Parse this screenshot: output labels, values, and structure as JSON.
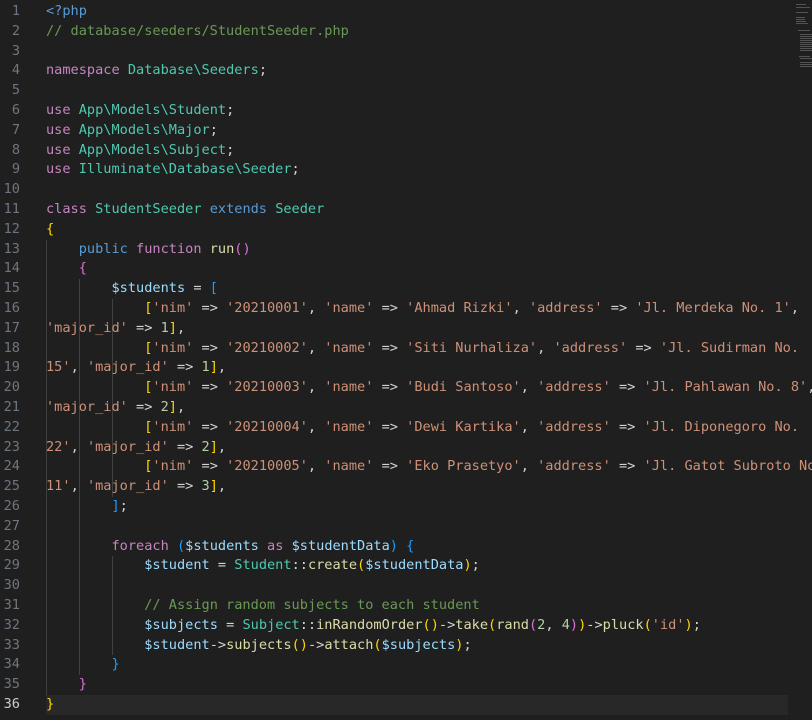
{
  "editor": {
    "file_comment": "// database/seeders/StudentSeeder.php",
    "active_line": 36,
    "line_numbers": [
      "1",
      "2",
      "3",
      "4",
      "5",
      "6",
      "7",
      "8",
      "9",
      "10",
      "11",
      "12",
      "13",
      "14",
      "15",
      "16",
      "17",
      "18",
      "19",
      "20",
      "21",
      "22",
      "23",
      "24",
      "25",
      "26",
      "27",
      "28",
      "29",
      "30",
      "31",
      "32",
      "33",
      "34",
      "35",
      "36"
    ],
    "lines": [
      [
        [
          "tok-php",
          "<?php"
        ]
      ],
      [
        [
          "tok-com",
          "// database/seeders/StudentSeeder.php"
        ]
      ],
      [],
      [
        [
          "tok-kw",
          "namespace"
        ],
        [
          "tok-op",
          " "
        ],
        [
          "tok-cls",
          "Database\\Seeders"
        ],
        [
          "tok-op",
          ";"
        ]
      ],
      [],
      [
        [
          "tok-kw",
          "use"
        ],
        [
          "tok-op",
          " "
        ],
        [
          "tok-cls",
          "App\\Models\\Student"
        ],
        [
          "tok-op",
          ";"
        ]
      ],
      [
        [
          "tok-kw",
          "use"
        ],
        [
          "tok-op",
          " "
        ],
        [
          "tok-cls",
          "App\\Models\\Major"
        ],
        [
          "tok-op",
          ";"
        ]
      ],
      [
        [
          "tok-kw",
          "use"
        ],
        [
          "tok-op",
          " "
        ],
        [
          "tok-cls",
          "App\\Models\\Subject"
        ],
        [
          "tok-op",
          ";"
        ]
      ],
      [
        [
          "tok-kw",
          "use"
        ],
        [
          "tok-op",
          " "
        ],
        [
          "tok-cls",
          "Illuminate\\Database\\Seeder"
        ],
        [
          "tok-op",
          ";"
        ]
      ],
      [],
      [
        [
          "tok-kw",
          "class"
        ],
        [
          "tok-op",
          " "
        ],
        [
          "tok-cls",
          "StudentSeeder"
        ],
        [
          "tok-op",
          " "
        ],
        [
          "tok-kw2",
          "extends"
        ],
        [
          "tok-op",
          " "
        ],
        [
          "tok-cls",
          "Seeder"
        ]
      ],
      [
        [
          "tok-b1",
          "{"
        ]
      ],
      [
        [
          "tok-op",
          "    "
        ],
        [
          "tok-decl",
          "public"
        ],
        [
          "tok-op",
          " "
        ],
        [
          "tok-kw",
          "function"
        ],
        [
          "tok-op",
          " "
        ],
        [
          "tok-fn",
          "run"
        ],
        [
          "tok-b2",
          "()"
        ]
      ],
      [
        [
          "tok-op",
          "    "
        ],
        [
          "tok-b2",
          "{"
        ]
      ],
      [
        [
          "tok-op",
          "        "
        ],
        [
          "tok-var",
          "$students"
        ],
        [
          "tok-op",
          " = "
        ],
        [
          "tok-b3",
          "["
        ]
      ],
      [
        [
          "tok-op",
          "            "
        ],
        [
          "tok-b1",
          "["
        ],
        [
          "tok-str",
          "'nim'"
        ],
        [
          "tok-op",
          " => "
        ],
        [
          "tok-str",
          "'20210001'"
        ],
        [
          "tok-op",
          ", "
        ],
        [
          "tok-str",
          "'name'"
        ],
        [
          "tok-op",
          " => "
        ],
        [
          "tok-str",
          "'Ahmad Rizki'"
        ],
        [
          "tok-op",
          ", "
        ],
        [
          "tok-str",
          "'address'"
        ],
        [
          "tok-op",
          " => "
        ],
        [
          "tok-str",
          "'Jl. Merdeka No. 1'"
        ],
        [
          "tok-op",
          ","
        ]
      ],
      [
        [
          "tok-str",
          "'major_id'"
        ],
        [
          "tok-op",
          " => "
        ],
        [
          "tok-num",
          "1"
        ],
        [
          "tok-b1",
          "]"
        ],
        [
          "tok-op",
          ","
        ]
      ],
      [
        [
          "tok-op",
          "            "
        ],
        [
          "tok-b1",
          "["
        ],
        [
          "tok-str",
          "'nim'"
        ],
        [
          "tok-op",
          " => "
        ],
        [
          "tok-str",
          "'20210002'"
        ],
        [
          "tok-op",
          ", "
        ],
        [
          "tok-str",
          "'name'"
        ],
        [
          "tok-op",
          " => "
        ],
        [
          "tok-str",
          "'Siti Nurhaliza'"
        ],
        [
          "tok-op",
          ", "
        ],
        [
          "tok-str",
          "'address'"
        ],
        [
          "tok-op",
          " => "
        ],
        [
          "tok-str",
          "'Jl. Sudirman No."
        ]
      ],
      [
        [
          "tok-str",
          "15'"
        ],
        [
          "tok-op",
          ", "
        ],
        [
          "tok-str",
          "'major_id'"
        ],
        [
          "tok-op",
          " => "
        ],
        [
          "tok-num",
          "1"
        ],
        [
          "tok-b1",
          "]"
        ],
        [
          "tok-op",
          ","
        ]
      ],
      [
        [
          "tok-op",
          "            "
        ],
        [
          "tok-b1",
          "["
        ],
        [
          "tok-str",
          "'nim'"
        ],
        [
          "tok-op",
          " => "
        ],
        [
          "tok-str",
          "'20210003'"
        ],
        [
          "tok-op",
          ", "
        ],
        [
          "tok-str",
          "'name'"
        ],
        [
          "tok-op",
          " => "
        ],
        [
          "tok-str",
          "'Budi Santoso'"
        ],
        [
          "tok-op",
          ", "
        ],
        [
          "tok-str",
          "'address'"
        ],
        [
          "tok-op",
          " => "
        ],
        [
          "tok-str",
          "'Jl. Pahlawan No. 8'"
        ],
        [
          "tok-op",
          ","
        ]
      ],
      [
        [
          "tok-str",
          "'major_id'"
        ],
        [
          "tok-op",
          " => "
        ],
        [
          "tok-num",
          "2"
        ],
        [
          "tok-b1",
          "]"
        ],
        [
          "tok-op",
          ","
        ]
      ],
      [
        [
          "tok-op",
          "            "
        ],
        [
          "tok-b1",
          "["
        ],
        [
          "tok-str",
          "'nim'"
        ],
        [
          "tok-op",
          " => "
        ],
        [
          "tok-str",
          "'20210004'"
        ],
        [
          "tok-op",
          ", "
        ],
        [
          "tok-str",
          "'name'"
        ],
        [
          "tok-op",
          " => "
        ],
        [
          "tok-str",
          "'Dewi Kartika'"
        ],
        [
          "tok-op",
          ", "
        ],
        [
          "tok-str",
          "'address'"
        ],
        [
          "tok-op",
          " => "
        ],
        [
          "tok-str",
          "'Jl. Diponegoro No."
        ]
      ],
      [
        [
          "tok-str",
          "22'"
        ],
        [
          "tok-op",
          ", "
        ],
        [
          "tok-str",
          "'major_id'"
        ],
        [
          "tok-op",
          " => "
        ],
        [
          "tok-num",
          "2"
        ],
        [
          "tok-b1",
          "]"
        ],
        [
          "tok-op",
          ","
        ]
      ],
      [
        [
          "tok-op",
          "            "
        ],
        [
          "tok-b1",
          "["
        ],
        [
          "tok-str",
          "'nim'"
        ],
        [
          "tok-op",
          " => "
        ],
        [
          "tok-str",
          "'20210005'"
        ],
        [
          "tok-op",
          ", "
        ],
        [
          "tok-str",
          "'name'"
        ],
        [
          "tok-op",
          " => "
        ],
        [
          "tok-str",
          "'Eko Prasetyo'"
        ],
        [
          "tok-op",
          ", "
        ],
        [
          "tok-str",
          "'address'"
        ],
        [
          "tok-op",
          " => "
        ],
        [
          "tok-str",
          "'Jl. Gatot Subroto No."
        ]
      ],
      [
        [
          "tok-str",
          "11'"
        ],
        [
          "tok-op",
          ", "
        ],
        [
          "tok-str",
          "'major_id'"
        ],
        [
          "tok-op",
          " => "
        ],
        [
          "tok-num",
          "3"
        ],
        [
          "tok-b1",
          "]"
        ],
        [
          "tok-op",
          ","
        ]
      ],
      [
        [
          "tok-op",
          "        "
        ],
        [
          "tok-b3",
          "]"
        ],
        [
          "tok-op",
          ";"
        ]
      ],
      [],
      [
        [
          "tok-op",
          "        "
        ],
        [
          "tok-kw",
          "foreach"
        ],
        [
          "tok-op",
          " "
        ],
        [
          "tok-b3",
          "("
        ],
        [
          "tok-var",
          "$students"
        ],
        [
          "tok-op",
          " "
        ],
        [
          "tok-kw",
          "as"
        ],
        [
          "tok-op",
          " "
        ],
        [
          "tok-var",
          "$studentData"
        ],
        [
          "tok-b3",
          ")"
        ],
        [
          "tok-op",
          " "
        ],
        [
          "tok-b3",
          "{"
        ]
      ],
      [
        [
          "tok-op",
          "            "
        ],
        [
          "tok-var",
          "$student"
        ],
        [
          "tok-op",
          " = "
        ],
        [
          "tok-cls",
          "Student"
        ],
        [
          "tok-op",
          "::"
        ],
        [
          "tok-fn",
          "create"
        ],
        [
          "tok-b1",
          "("
        ],
        [
          "tok-var",
          "$studentData"
        ],
        [
          "tok-b1",
          ")"
        ],
        [
          "tok-op",
          ";"
        ]
      ],
      [],
      [
        [
          "tok-op",
          "            "
        ],
        [
          "tok-com",
          "// Assign random subjects to each student"
        ]
      ],
      [
        [
          "tok-op",
          "            "
        ],
        [
          "tok-var",
          "$subjects"
        ],
        [
          "tok-op",
          " = "
        ],
        [
          "tok-cls",
          "Subject"
        ],
        [
          "tok-op",
          "::"
        ],
        [
          "tok-fn",
          "inRandomOrder"
        ],
        [
          "tok-b1",
          "()"
        ],
        [
          "tok-op",
          "->"
        ],
        [
          "tok-fn",
          "take"
        ],
        [
          "tok-b1",
          "("
        ],
        [
          "tok-fn",
          "rand"
        ],
        [
          "tok-b2",
          "("
        ],
        [
          "tok-num",
          "2"
        ],
        [
          "tok-op",
          ", "
        ],
        [
          "tok-num",
          "4"
        ],
        [
          "tok-b2",
          ")"
        ],
        [
          "tok-b1",
          ")"
        ],
        [
          "tok-op",
          "->"
        ],
        [
          "tok-fn",
          "pluck"
        ],
        [
          "tok-b1",
          "("
        ],
        [
          "tok-str",
          "'id'"
        ],
        [
          "tok-b1",
          ")"
        ],
        [
          "tok-op",
          ";"
        ]
      ],
      [
        [
          "tok-op",
          "            "
        ],
        [
          "tok-var",
          "$student"
        ],
        [
          "tok-op",
          "->"
        ],
        [
          "tok-fn",
          "subjects"
        ],
        [
          "tok-b1",
          "()"
        ],
        [
          "tok-op",
          "->"
        ],
        [
          "tok-fn",
          "attach"
        ],
        [
          "tok-b1",
          "("
        ],
        [
          "tok-var",
          "$subjects"
        ],
        [
          "tok-b1",
          ")"
        ],
        [
          "tok-op",
          ";"
        ]
      ],
      [
        [
          "tok-op",
          "        "
        ],
        [
          "tok-b3",
          "}"
        ]
      ],
      [
        [
          "tok-op",
          "    "
        ],
        [
          "tok-b2",
          "}"
        ]
      ],
      [
        [
          "tok-b1",
          "}"
        ]
      ]
    ]
  }
}
